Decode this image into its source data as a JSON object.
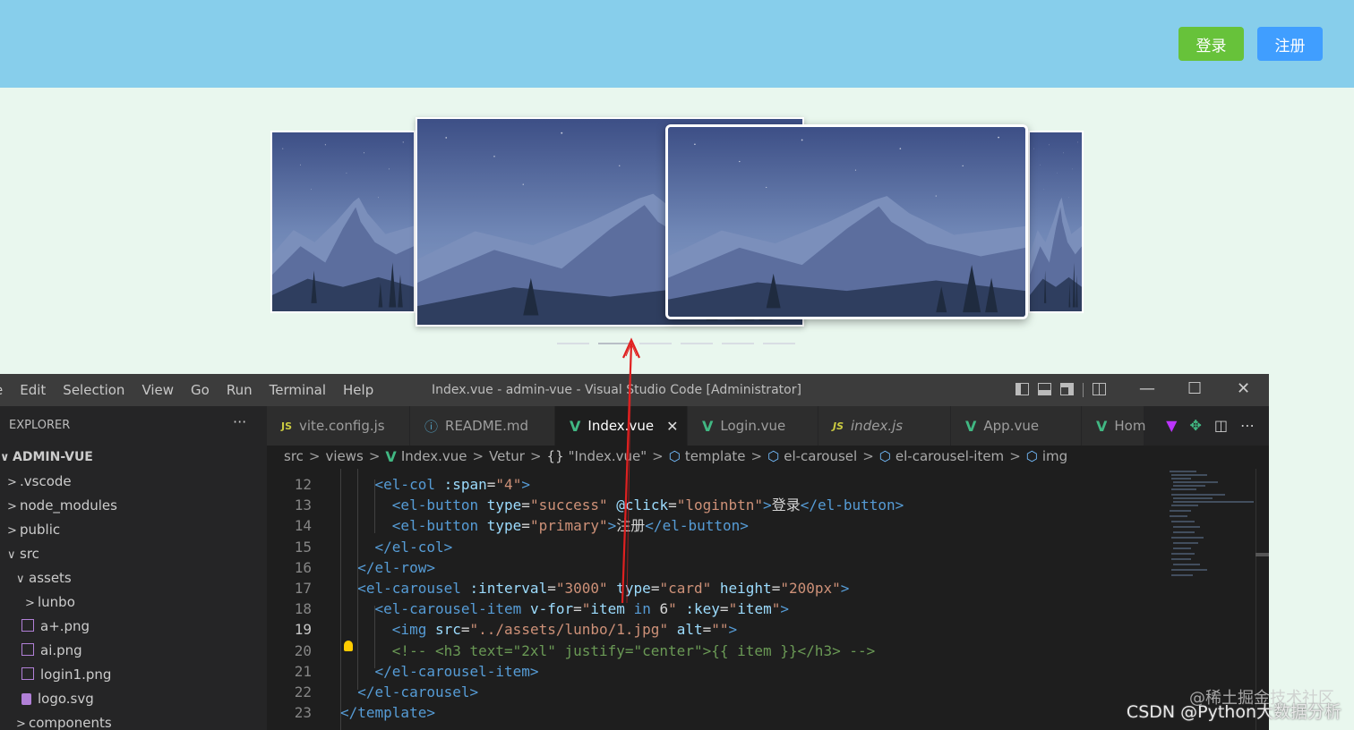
{
  "header": {
    "login_label": "登录",
    "register_label": "注册",
    "colors": {
      "bar": "#87ceeb",
      "login": "#67c23a",
      "register": "#409eff"
    }
  },
  "carousel": {
    "slides_visible": 4,
    "indicator_count": 6,
    "active_indicator": 1
  },
  "vscode": {
    "menu": [
      "e",
      "Edit",
      "Selection",
      "View",
      "Go",
      "Run",
      "Terminal",
      "Help"
    ],
    "window_title": "Index.vue - admin-vue - Visual Studio Code [Administrator]",
    "explorer": {
      "header": "EXPLORER",
      "more": "···",
      "root": "ADMIN-VUE",
      "items": [
        ".vscode",
        "node_modules",
        "public",
        "src",
        "assets",
        "lunbo",
        "a+.png",
        "ai.png",
        "login1.png",
        "logo.svg",
        "components"
      ]
    },
    "tabs": [
      {
        "icon": "js-icon",
        "label": "vite.config.js"
      },
      {
        "icon": "info-icon",
        "label": "README.md"
      },
      {
        "icon": "vue-icon",
        "label": "Index.vue"
      },
      {
        "icon": "vue-icon",
        "label": "Login.vue"
      },
      {
        "icon": "js-icon",
        "label": "index.js"
      },
      {
        "icon": "vue-icon",
        "label": "App.vue"
      },
      {
        "icon": "vue-icon",
        "label": "Hom"
      }
    ],
    "breadcrumb": [
      "src",
      "views",
      "Index.vue",
      "Vetur",
      "\"Index.vue\"",
      "template",
      "el-carousel",
      "el-carousel-item",
      "img"
    ],
    "code": [
      {
        "n": "12",
        "html": "    <span class='t-tag'>&lt;el-col</span> <span class='t-attr'>:span</span><span class='t-txt'>=</span><span class='t-str'>\"4\"</span><span class='t-tag'>&gt;</span>"
      },
      {
        "n": "13",
        "html": "      <span class='t-tag'>&lt;el-button</span> <span class='t-attr'>type</span><span class='t-txt'>=</span><span class='t-str'>\"success\"</span> <span class='t-attr'>@click</span><span class='t-txt'>=</span><span class='t-str'>\"loginbtn\"</span><span class='t-tag'>&gt;</span><span class='t-txt'>登录</span><span class='t-tag'>&lt;/el-button&gt;</span>"
      },
      {
        "n": "14",
        "html": "      <span class='t-tag'>&lt;el-button</span> <span class='t-attr'>type</span><span class='t-txt'>=</span><span class='t-str'>\"primary\"</span><span class='t-tag'>&gt;</span><span class='t-txt'>注册</span><span class='t-tag'>&lt;/el-button&gt;</span>"
      },
      {
        "n": "15",
        "html": "    <span class='t-tag'>&lt;/el-col&gt;</span>"
      },
      {
        "n": "16",
        "html": "  <span class='t-tag'>&lt;/el-row&gt;</span>"
      },
      {
        "n": "17",
        "html": "  <span class='t-tag'>&lt;el-carousel</span> <span class='t-attr'>:interval</span><span class='t-txt'>=</span><span class='t-str'>\"3000\"</span> <span class='t-attr'>type</span><span class='t-txt'>=</span><span class='t-str'>\"card\"</span> <span class='t-attr'>height</span><span class='t-txt'>=</span><span class='t-str'>\"200px\"</span><span class='t-tag'>&gt;</span>"
      },
      {
        "n": "18",
        "html": "    <span class='t-tag'>&lt;el-carousel-item</span> <span class='t-attr'>v-for</span><span class='t-txt'>=</span><span class='t-str'>\"</span><span class='t-attr'>item</span> <span class='t-tag'>in</span> <span class='t-txt'>6</span><span class='t-str'>\"</span> <span class='t-attr'>:key</span><span class='t-txt'>=</span><span class='t-str'>\"</span><span class='t-attr'>item</span><span class='t-str'>\"</span><span class='t-tag'>&gt;</span>"
      },
      {
        "n": "19",
        "html": "      <span class='t-tag'>&lt;img</span> <span class='t-attr'>src</span><span class='t-txt'>=</span><span class='t-str'>\"../assets/lunbo/1.jpg\"</span> <span class='t-attr'>alt</span><span class='t-txt'>=</span><span class='t-str'>\"\"</span><span class='t-tag'>&gt;</span>"
      },
      {
        "n": "20",
        "html": "      <span class='t-cmt'>&lt;!-- &lt;h3 text=\"2xl\" justify=\"center\"&gt;{{ item }}&lt;/h3&gt; --&gt;</span>"
      },
      {
        "n": "21",
        "html": "    <span class='t-tag'>&lt;/el-carousel-item&gt;</span>"
      },
      {
        "n": "22",
        "html": "  <span class='t-tag'>&lt;/el-carousel&gt;</span>"
      },
      {
        "n": "23",
        "html": "<span class='t-tag'>&lt;/template&gt;</span>"
      }
    ],
    "current_line": "19"
  },
  "watermark": {
    "line1": "@稀土掘金技术社区",
    "line2": "CSDN @Python大数据分析"
  }
}
